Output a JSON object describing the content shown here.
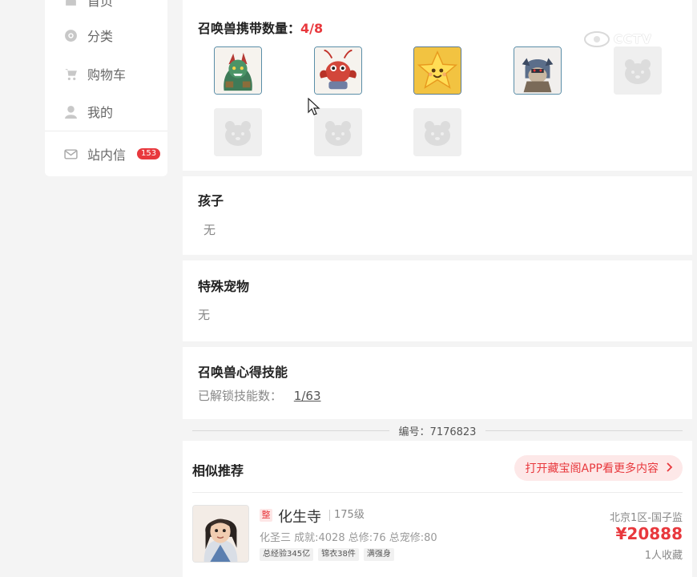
{
  "sidebar": {
    "items": [
      {
        "label": "首页",
        "icon": "home-icon"
      },
      {
        "label": "分类",
        "icon": "category-icon"
      },
      {
        "label": "购物车",
        "icon": "cart-icon"
      },
      {
        "label": "我的",
        "icon": "user-icon"
      }
    ],
    "messages": {
      "label": "站内信",
      "icon": "mail-icon",
      "badge": "153"
    }
  },
  "summons": {
    "title": "召唤兽携带数量：",
    "count": "4/8",
    "slots": [
      {
        "filled": true,
        "icon": "summon-green-beast-icon"
      },
      {
        "filled": true,
        "icon": "summon-red-crab-icon"
      },
      {
        "filled": true,
        "icon": "summon-yellow-star-icon"
      },
      {
        "filled": true,
        "icon": "summon-armored-beast-icon"
      },
      {
        "filled": false,
        "icon": "empty-slot-icon"
      },
      {
        "filled": false,
        "icon": "empty-slot-icon"
      },
      {
        "filled": false,
        "icon": "empty-slot-icon"
      },
      {
        "filled": false,
        "icon": "empty-slot-icon"
      }
    ]
  },
  "children": {
    "title": "孩子",
    "value": "无"
  },
  "special_pets": {
    "title": "特殊宠物",
    "value": "无"
  },
  "summon_skills": {
    "title": "召唤兽心得技能",
    "label": "已解锁技能数：",
    "value": "1/63"
  },
  "serial": {
    "text": "编号：7176823"
  },
  "recommend": {
    "title": "相似推荐",
    "open_app": "打开藏宝阁APP看更多内容",
    "items": [
      {
        "badge": "整",
        "name": "化生寺",
        "level": "175级",
        "stats": "化圣三 成就:4028 总修:76 总宠修:80",
        "tags": [
          "总经验345亿",
          "锦衣38件",
          "满强身"
        ],
        "server": "北京1区-国子监",
        "price": "¥20888",
        "favorites": "1人收藏"
      }
    ]
  },
  "watermark": {
    "text": "CCTV"
  },
  "colors": {
    "accent": "#e8383d",
    "card_bg": "#ffffff",
    "page_bg": "#f4f4f4"
  }
}
